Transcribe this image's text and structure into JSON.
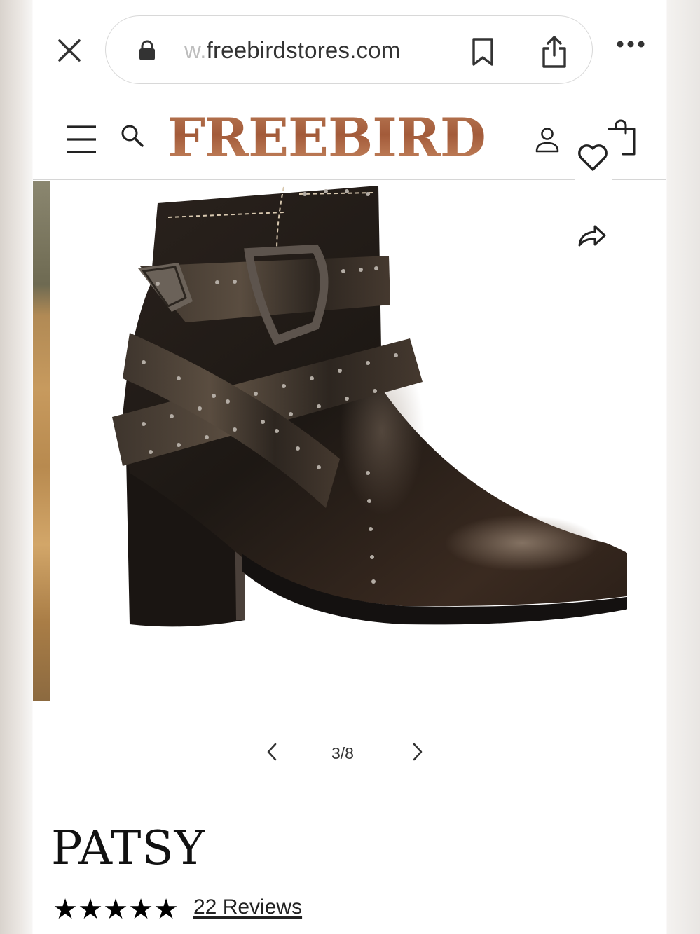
{
  "browser": {
    "url_faint": "w.",
    "url_main": "freebirdstores.com"
  },
  "header": {
    "logo_text": "FREEBIRD"
  },
  "gallery": {
    "current": 3,
    "total": 8,
    "counter_text": "3/8"
  },
  "product": {
    "name": "PATSY",
    "rating": 5,
    "stars": [
      "★",
      "★",
      "★",
      "★",
      "★"
    ],
    "reviews_text": "22 Reviews"
  },
  "colors": {
    "logo": "#a35b3a",
    "text": "#111111"
  },
  "icons": [
    "close-icon",
    "lock-icon",
    "bookmark-icon",
    "share-icon",
    "more-icon",
    "menu-icon",
    "search-icon",
    "account-icon",
    "heart-icon",
    "bag-icon",
    "forward-share-icon",
    "chevron-left-icon",
    "chevron-right-icon",
    "star-icon"
  ]
}
